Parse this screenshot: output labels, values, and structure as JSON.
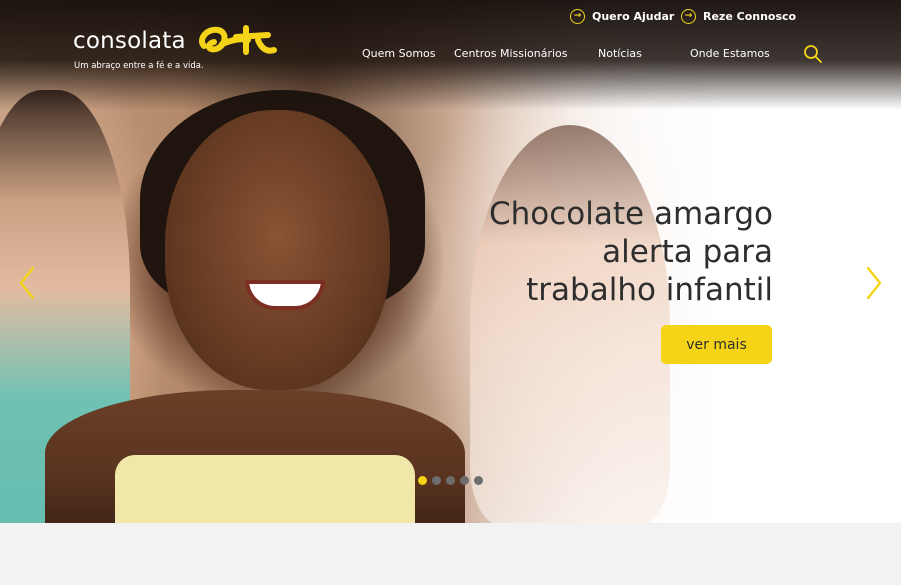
{
  "brand": {
    "name": "consolata",
    "tagline": "Um abraço entre a fé e a vida.",
    "accent_color": "#f5d417",
    "logo_icon": "consolata-mark-icon"
  },
  "utility_links": [
    {
      "label": "Quero Ajudar",
      "icon": "arrow-circle-icon"
    },
    {
      "label": "Reze Connosco",
      "icon": "arrow-circle-icon"
    }
  ],
  "nav": {
    "items": [
      {
        "label": "Quem Somos"
      },
      {
        "label": "Centros Missionários"
      },
      {
        "label": "Notícias"
      },
      {
        "label": "Onde Estamos"
      }
    ],
    "search_icon": "search-icon"
  },
  "hero": {
    "headline_lines": [
      "Chocolate amargo",
      "alerta para",
      "trabalho infantil"
    ],
    "cta_label": "ver mais",
    "prev_icon": "chevron-left-icon",
    "next_icon": "chevron-right-icon",
    "slides_total": 5,
    "active_slide": 1
  }
}
